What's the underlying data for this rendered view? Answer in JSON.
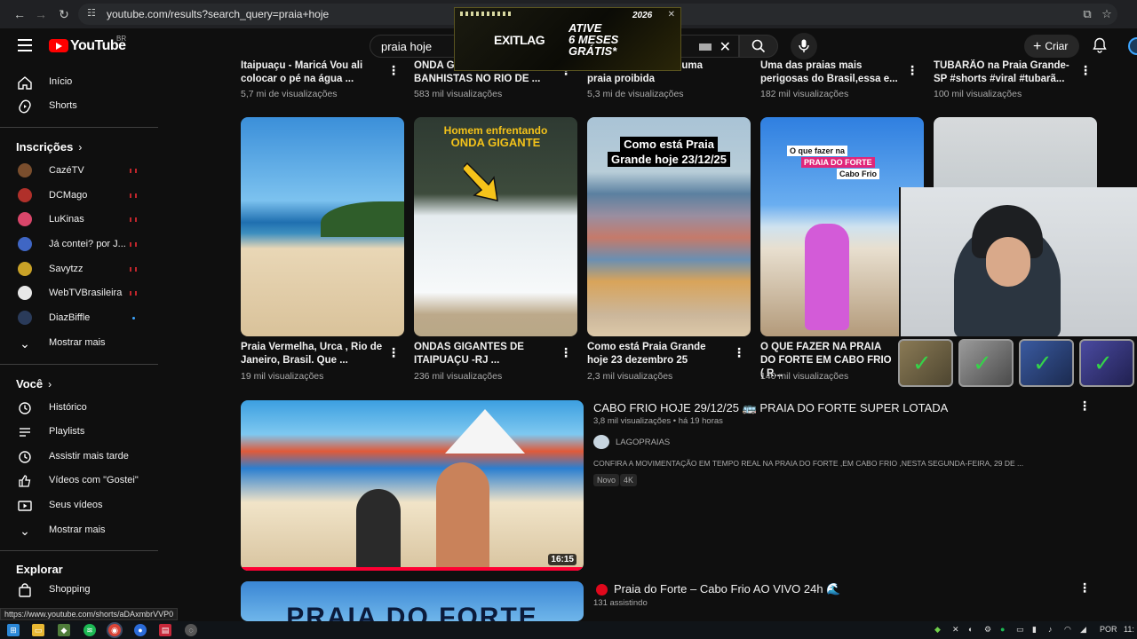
{
  "browser": {
    "url": "youtube.com/results?search_query=praia+hoje",
    "status_url": "https://www.youtube.com/shorts/aDAxmbrVVP0"
  },
  "header": {
    "logo_text": "YouTube",
    "country_code": "BR",
    "search_value": "praia hoje",
    "create_label": "Criar"
  },
  "ad": {
    "brand": "EXITLAG",
    "cta_line1": "ATIVE",
    "cta_line2": "6 MESES",
    "cta_line3": "GRÁTIS*",
    "year": "2026"
  },
  "sidebar": {
    "main": [
      {
        "label": "Início",
        "icon": "home-icon"
      },
      {
        "label": "Shorts",
        "icon": "shorts-icon"
      }
    ],
    "subscriptions_title": "Inscrições",
    "subscriptions": [
      {
        "label": "CazéTV",
        "live": true,
        "color": "#7a4e2d"
      },
      {
        "label": "DCMago",
        "live": true,
        "color": "#b0302a"
      },
      {
        "label": "LuKinas",
        "live": true,
        "color": "#d9466a"
      },
      {
        "label": "Já contei? por J...",
        "live": true,
        "color": "#3f66c4"
      },
      {
        "label": "Savytzz",
        "live": true,
        "color": "#c9a227"
      },
      {
        "label": "WebTVBrasileira",
        "live": true,
        "color": "#e8e8e8"
      },
      {
        "label": "DiazBiffle",
        "live": false,
        "color": "#2a3b5a"
      }
    ],
    "show_more_1": "Mostrar mais",
    "you_title": "Você",
    "you_items": [
      {
        "label": "Histórico",
        "icon": "history-icon"
      },
      {
        "label": "Playlists",
        "icon": "playlists-icon"
      },
      {
        "label": "Assistir mais tarde",
        "icon": "watch-later-icon"
      },
      {
        "label": "Vídeos com \"Gostei\"",
        "icon": "like-icon"
      },
      {
        "label": "Seus vídeos",
        "icon": "your-videos-icon"
      }
    ],
    "show_more_2": "Mostrar mais",
    "explore_title": "Explorar",
    "explore_items": [
      {
        "label": "Shopping",
        "icon": "shopping-icon"
      }
    ]
  },
  "top_partial_row": [
    {
      "line1": "Itaipuaçu - Maricá Vou ali",
      "line2": "colocar o pé na água ...",
      "views": "5,7 mi de visualizações"
    },
    {
      "line1": "ONDA G",
      "line2": "BANHISTAS NO RIO DE ...",
      "views": "583 mil visualizações"
    },
    {
      "line1": "uma",
      "line2": "praia proibida",
      "views": "5,3 mi de visualizações"
    },
    {
      "line1": "Uma das praias mais",
      "line2": "perigosas do Brasil,essa e...",
      "views": "182 mil visualizações"
    },
    {
      "line1": "TUBARÃO na Praia Grande-",
      "line2": "SP  #shorts #viral #tubarã...",
      "views": "100 mil visualizações"
    }
  ],
  "shorts": [
    {
      "title": "Praia Vermelha, Urca , Rio de Janeiro, Brasil. Que ...",
      "views": "19 mil visualizações",
      "overlay": ""
    },
    {
      "title": "ONDAS GIGANTES DE ITAIPUAÇU -RJ ...",
      "views": "236 mil visualizações",
      "overlay1": "Homem enfrentando",
      "overlay2": "ONDA GIGANTE"
    },
    {
      "title": "Como está Praia Grande hoje 23 dezembro 25",
      "views": "2,3 mil visualizações",
      "overlay1": "Como está Praia",
      "overlay2": "Grande hoje 23/12/25"
    },
    {
      "title": "O QUE FAZER NA PRAIA DO FORTE EM CABO FRIO ( R...",
      "views": "140 mil visualizações",
      "overlay1": "O que fazer na",
      "overlay2": "PRAIA DO FORTE",
      "overlay3": "Cabo Frio"
    },
    {
      "title": "",
      "views": ""
    }
  ],
  "videos": [
    {
      "title": "CABO FRIO HOJE 29/12/25 🚌 PRAIA DO FORTE SUPER LOTADA",
      "meta": "3,8 mil visualizações • há 19 horas",
      "channel": "LAGOPRAIAS",
      "description": "CONFIRA A MOVIMENTAÇÃO EM TEMPO REAL NA PRAIA DO FORTE ,EM CABO FRIO ,NESTA SEGUNDA-FEIRA, 29 DE ...",
      "badges": [
        "Novo",
        "4K"
      ],
      "duration": "16:15"
    },
    {
      "title": "Praia do Forte – Cabo Frio AO VIVO 24h 🌊",
      "meta": "131 assistindo",
      "thumb_text": "PRAIA DO FORTE"
    }
  ],
  "taskbar": {
    "lang": "POR",
    "time": "11:"
  }
}
